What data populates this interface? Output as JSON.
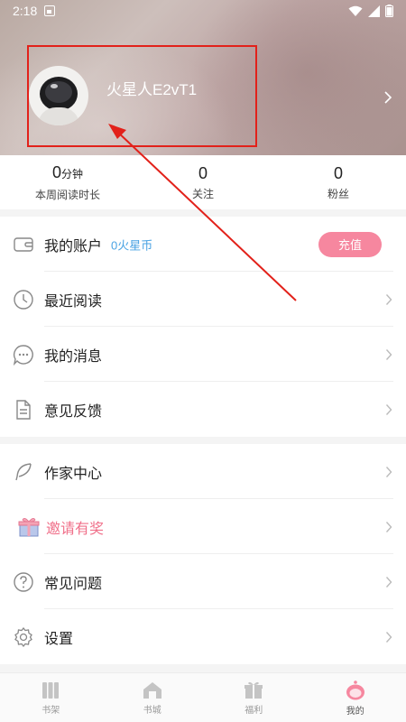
{
  "status_bar": {
    "time": "2:18"
  },
  "profile": {
    "username": "火星人E2vT1"
  },
  "stats": [
    {
      "value": "0",
      "unit": "分钟",
      "label": "本周阅读时长"
    },
    {
      "value": "0",
      "unit": "",
      "label": "关注"
    },
    {
      "value": "0",
      "unit": "",
      "label": "粉丝"
    }
  ],
  "account": {
    "label": "我的账户",
    "coins": "0火星币",
    "recharge_label": "充值"
  },
  "menu_group_1": [
    {
      "label": "最近阅读",
      "icon": "clock-icon"
    },
    {
      "label": "我的消息",
      "icon": "message-bubble-icon"
    },
    {
      "label": "意见反馈",
      "icon": "document-icon"
    }
  ],
  "menu_group_2": [
    {
      "label": "作家中心",
      "icon": "feather-icon"
    },
    {
      "label": "邀请有奖",
      "icon": "gift-icon",
      "color": "#f0708a"
    },
    {
      "label": "常见问题",
      "icon": "question-icon"
    },
    {
      "label": "设置",
      "icon": "gear-icon"
    }
  ],
  "tabbar": {
    "items": [
      {
        "label": "书架",
        "icon": "bookshelf-icon"
      },
      {
        "label": "书城",
        "icon": "bookstore-icon"
      },
      {
        "label": "福利",
        "icon": "gift-icon"
      },
      {
        "label": "我的",
        "icon": "profile-icon",
        "active": true
      }
    ]
  },
  "colors": {
    "accent_pink": "#f6879f",
    "link_blue": "#4aa3e3",
    "annotation_red": "#e2211a"
  }
}
